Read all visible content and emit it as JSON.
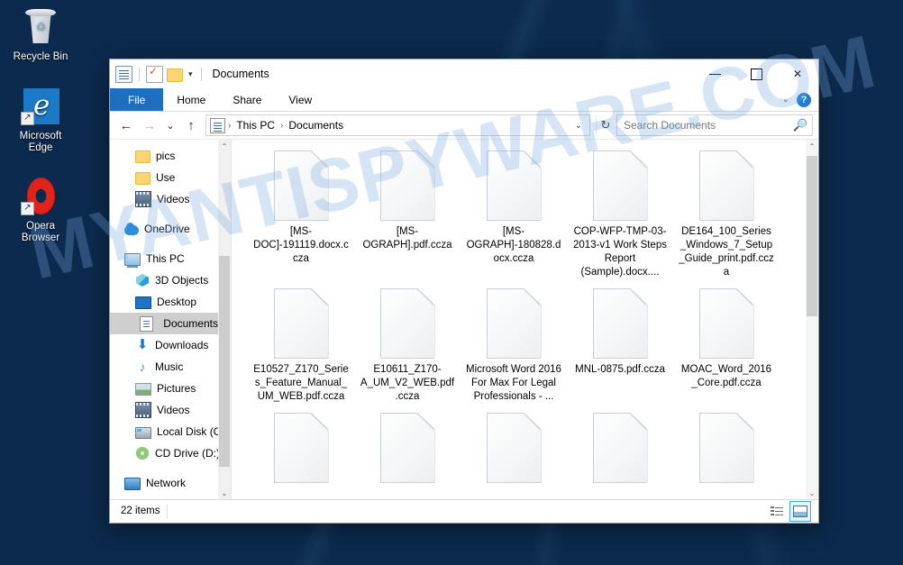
{
  "desktop": {
    "icons": [
      {
        "label": "Recycle Bin",
        "icon": "recycle-bin-icon"
      },
      {
        "label": "Microsoft\nEdge",
        "label_line1": "Microsoft",
        "label_line2": "Edge",
        "icon": "edge-icon"
      },
      {
        "label": "Opera\nBrowser",
        "label_line1": "Opera",
        "label_line2": "Browser",
        "icon": "opera-icon"
      }
    ]
  },
  "watermark": {
    "text": "MYANTISPYWARE.COM",
    "color": "#78aae1"
  },
  "window": {
    "title": "Documents",
    "quick_access": [
      {
        "name": "documents-properties-icon",
        "label": ""
      },
      {
        "name": "properties-icon",
        "label": ""
      },
      {
        "name": "new-folder-icon",
        "label": ""
      },
      {
        "name": "customize-qat-chevron",
        "label": "▾"
      }
    ],
    "caption": {
      "minimize": "—",
      "maximize": "▢",
      "close": "✕"
    },
    "ribbon_tabs": [
      {
        "label": "File",
        "active": true
      },
      {
        "label": "Home",
        "active": false
      },
      {
        "label": "Share",
        "active": false
      },
      {
        "label": "View",
        "active": false
      }
    ],
    "ribbon_right": {
      "expand_chevron": "⌄",
      "help": "?"
    },
    "nav": {
      "back": "←",
      "forward": "→",
      "recent": "⌄",
      "up": "↑"
    },
    "breadcrumb": {
      "root_icon": "documents-icon",
      "items": [
        "This PC",
        "Documents"
      ],
      "separator": "›",
      "dropdown": "⌄"
    },
    "refresh": "↻",
    "search": {
      "placeholder": "Search Documents",
      "value": "",
      "icon": "search-icon"
    }
  },
  "sidebar": {
    "items": [
      {
        "label": "pics",
        "icon": "folder-icon",
        "indent": 1,
        "selected": false,
        "gap_before": false
      },
      {
        "label": "Use",
        "icon": "folder-icon",
        "indent": 1,
        "selected": false,
        "gap_before": false
      },
      {
        "label": "Videos",
        "icon": "videos-icon",
        "indent": 1,
        "selected": false,
        "gap_before": false
      },
      {
        "label": "OneDrive",
        "icon": "onedrive-icon",
        "indent": 0,
        "selected": false,
        "gap_before": true
      },
      {
        "label": "This PC",
        "icon": "this-pc-icon",
        "indent": 0,
        "selected": false,
        "gap_before": true
      },
      {
        "label": "3D Objects",
        "icon": "3d-objects-icon",
        "indent": 1,
        "selected": false,
        "gap_before": false
      },
      {
        "label": "Desktop",
        "icon": "desktop-icon",
        "indent": 1,
        "selected": false,
        "gap_before": false
      },
      {
        "label": "Documents",
        "icon": "documents-icon",
        "indent": 1,
        "selected": true,
        "gap_before": false
      },
      {
        "label": "Downloads",
        "icon": "downloads-icon",
        "indent": 1,
        "selected": false,
        "gap_before": false
      },
      {
        "label": "Music",
        "icon": "music-icon",
        "indent": 1,
        "selected": false,
        "gap_before": false
      },
      {
        "label": "Pictures",
        "icon": "pictures-icon",
        "indent": 1,
        "selected": false,
        "gap_before": false
      },
      {
        "label": "Videos",
        "icon": "videos-icon",
        "indent": 1,
        "selected": false,
        "gap_before": false
      },
      {
        "label": "Local Disk (C:)",
        "icon": "local-disk-icon",
        "indent": 1,
        "selected": false,
        "gap_before": false
      },
      {
        "label": "CD Drive (D:) CC",
        "icon": "cd-drive-icon",
        "indent": 1,
        "selected": false,
        "gap_before": false
      },
      {
        "label": "Network",
        "icon": "network-icon",
        "indent": 0,
        "selected": false,
        "gap_before": true
      }
    ],
    "scroll_up": "⌃",
    "scroll_down": "⌄"
  },
  "files": [
    {
      "name": "[MS-DOC]-191119.docx.ccza"
    },
    {
      "name": "[MS-OGRAPH].pdf.ccza"
    },
    {
      "name": "[MS-OGRAPH]-180828.docx.ccza"
    },
    {
      "name": "COP-WFP-TMP-03-2013-v1 Work Steps Report (Sample).docx...."
    },
    {
      "name": "DE164_100_Series_Windows_7_Setup_Guide_print.pdf.ccza"
    },
    {
      "name": "E10527_Z170_Series_Feature_Manual_UM_WEB.pdf.ccza"
    },
    {
      "name": "E10611_Z170-A_UM_V2_WEB.pdf.ccza"
    },
    {
      "name": "Microsoft Word 2016 For Max For Legal Professionals - ..."
    },
    {
      "name": "MNL-0875.pdf.ccza"
    },
    {
      "name": "MOAC_Word_2016_Core.pdf.ccza"
    },
    {
      "name": ""
    },
    {
      "name": ""
    },
    {
      "name": ""
    },
    {
      "name": ""
    },
    {
      "name": ""
    }
  ],
  "content_scroll": {
    "up": "⌃",
    "down": "⌄"
  },
  "status": {
    "item_count": "22 items",
    "views": [
      {
        "name": "details-view-button",
        "active": false
      },
      {
        "name": "large-icons-view-button",
        "active": true
      }
    ]
  }
}
